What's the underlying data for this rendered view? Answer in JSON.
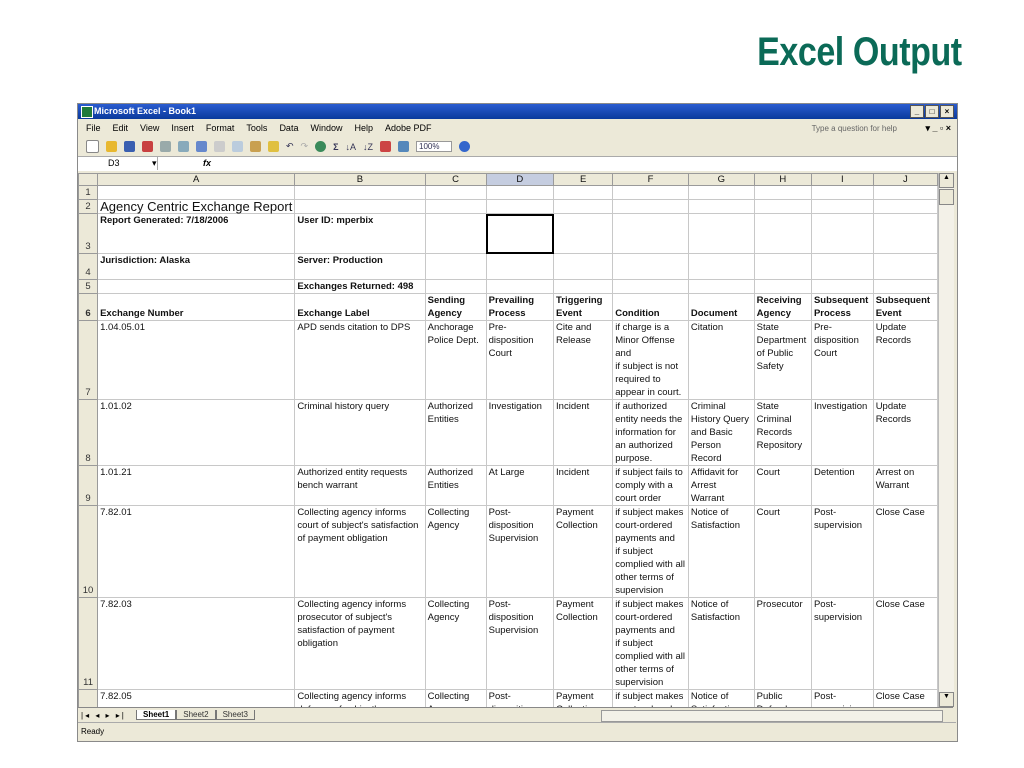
{
  "slide_title": "Excel Output",
  "window": {
    "title": "Microsoft Excel - Book1"
  },
  "menu": [
    "File",
    "Edit",
    "View",
    "Insert",
    "Format",
    "Tools",
    "Data",
    "Window",
    "Help",
    "Adobe PDF"
  ],
  "help_placeholder": "Type a question for help",
  "zoom": "100%",
  "name_box": "D3",
  "fx_label": "fx",
  "columns": [
    "A",
    "B",
    "C",
    "D",
    "E",
    "F",
    "G",
    "H",
    "I",
    "J"
  ],
  "report": {
    "title": "Agency Centric Exchange Report",
    "generated": "Report Generated: 7/18/2006",
    "user": "User ID: mperbix",
    "jurisdiction": "Jurisdiction: Alaska",
    "server": "Server: Production",
    "returned": "Exchanges Returned: 498"
  },
  "headers": [
    "Exchange Number",
    "Exchange Label",
    "Sending Agency",
    "Prevailing Process",
    "Triggering Event",
    "Condition",
    "Document",
    "Receiving Agency",
    "Subsequent Process",
    "Subsequent Event"
  ],
  "rows": [
    [
      "1.04.05.01",
      "APD sends citation to DPS",
      "Anchorage Police Dept.",
      "Pre-disposition Court",
      "Cite and Release",
      "if charge  is a Minor Offense and\nif subject  is not required to appear in court.",
      "Citation",
      "State Department of Public Safety",
      "Pre-disposition Court",
      "Update Records"
    ],
    [
      "1.01.02",
      "Criminal history query",
      "Authorized Entities",
      "Investigation",
      "Incident",
      "if authorized entity needs the information for an authorized purpose.",
      "Criminal History Query and Basic Person Record",
      "State Criminal Records Repository",
      "Investigation",
      "Update Records"
    ],
    [
      "1.01.21",
      "Authorized entity requests bench warrant",
      "Authorized Entities",
      "At Large",
      "Incident",
      "if subject  fails to comply with a court order",
      "Affidavit for Arrest Warrant",
      "Court",
      "Detention",
      "Arrest on Warrant"
    ],
    [
      "7.82.01",
      "Collecting agency informs court of subject's satisfaction of payment obligation",
      "Collecting Agency",
      "Post-disposition Supervision",
      "Payment Collection",
      "if subject  makes court-ordered payments and\nif subject  complied with all other terms of supervision",
      "Notice of Satisfaction",
      "Court",
      "Post-supervision",
      "Close Case"
    ],
    [
      "7.82.03",
      "Collecting agency informs prosecutor of subject's satisfaction of payment obligation",
      "Collecting Agency",
      "Post-disposition Supervision",
      "Payment Collection",
      "if subject  makes court-ordered payments and\nif subject  complied with all other terms of supervision",
      "Notice of Satisfaction",
      "Prosecutor",
      "Post-supervision",
      "Close Case"
    ],
    [
      "7.82.05",
      "Collecting agency informs defense of subject's satisfaction of payment obligation",
      "Collecting Agency",
      "Post-disposition Supervision",
      "Payment Collection",
      "if subject  makes court-ordered payments and\nif subject  complied with all other terms of supervision",
      "Notice of Satisfaction",
      "Public Defender",
      "Post-supervision",
      "Close Case"
    ]
  ],
  "sheets": [
    "Sheet1",
    "Sheet2",
    "Sheet3"
  ],
  "status": "Ready"
}
